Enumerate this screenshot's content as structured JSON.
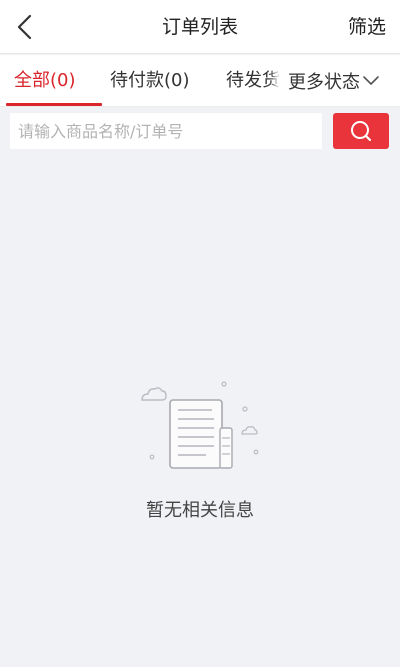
{
  "header": {
    "back_icon": "chevron-left-icon",
    "title": "订单列表",
    "filter_label": "筛选"
  },
  "tabs": [
    {
      "label": "全部(0)",
      "active": true
    },
    {
      "label": "待付款(0)",
      "active": false
    },
    {
      "label": "待发货",
      "active": false
    }
  ],
  "more_status": {
    "label": "更多状态",
    "icon": "chevron-down-icon"
  },
  "search": {
    "placeholder": "请输入商品名称/订单号",
    "value": "",
    "button_icon": "search-icon"
  },
  "empty_state": {
    "illustration": "empty-document-icon",
    "message": "暂无相关信息"
  },
  "colors": {
    "accent": "#d9252b",
    "search_button": "#e8343a",
    "background": "#f1f2f5"
  }
}
